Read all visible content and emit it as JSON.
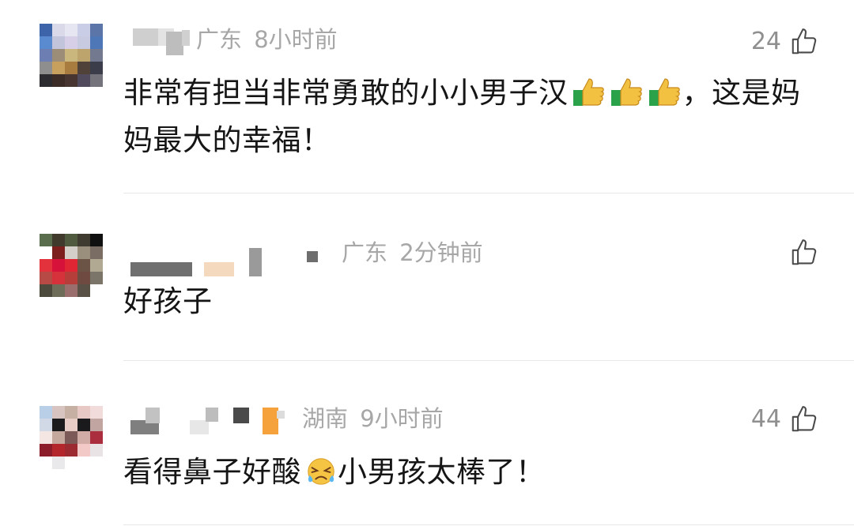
{
  "comments": [
    {
      "location": "广东",
      "time": "8小时前",
      "likes": "24",
      "text_parts": [
        "非常有担当非常勇敢的小小男子汉",
        "，这是妈妈最大的幸福！"
      ],
      "emoji": [
        "thumbs-up-icon",
        "thumbs-up-icon",
        "thumbs-up-icon"
      ]
    },
    {
      "location": "广东",
      "time": "2分钟前",
      "likes": "",
      "text_parts": [
        "好孩子"
      ]
    },
    {
      "location": "湖南",
      "time": "9小时前",
      "likes": "44",
      "text_parts": [
        "看得鼻子好酸",
        "小男孩太棒了！"
      ],
      "emoji": [
        "crying-face-icon"
      ]
    }
  ],
  "icons": {
    "like": "thumb-up-outline-icon",
    "accent_orange": "#f5a23c"
  }
}
